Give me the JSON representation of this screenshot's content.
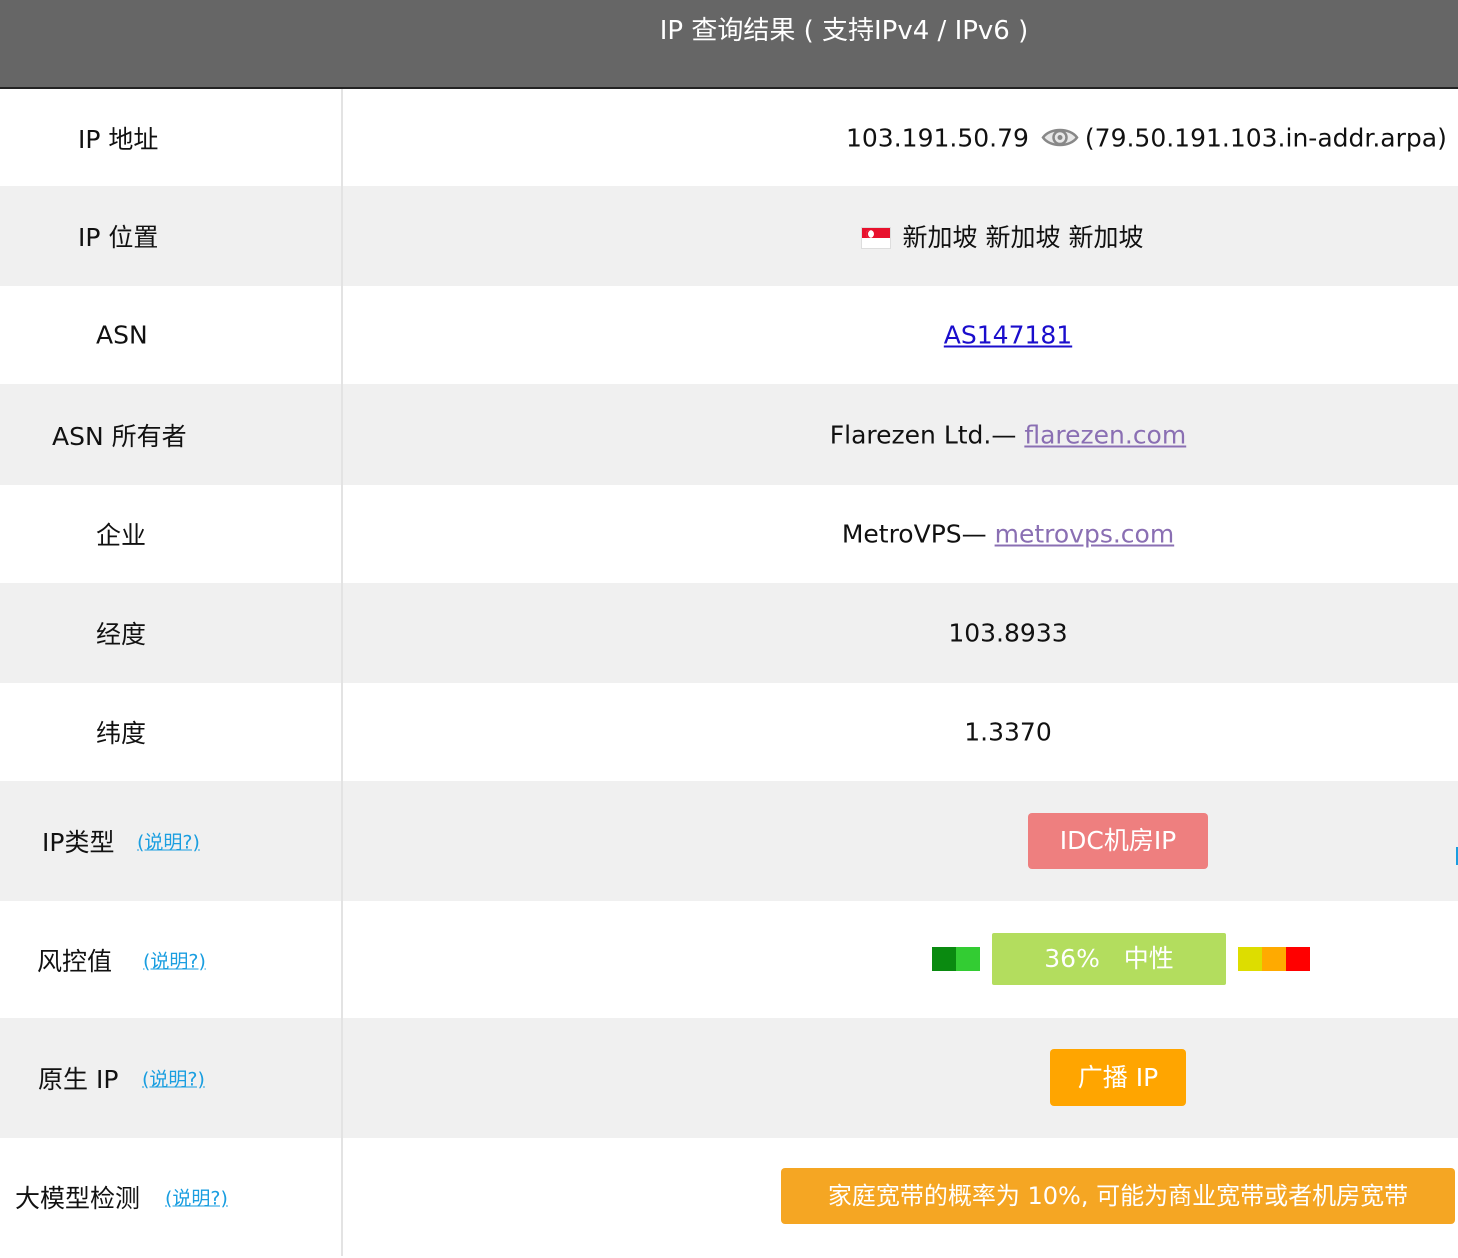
{
  "header": {
    "title": "IP 查询结果 ( 支持IPv4 / IPv6 )"
  },
  "rows": {
    "ip_address": {
      "label": "IP 地址",
      "ip": "103.191.50.79",
      "ptr": "(79.50.191.103.in-addr.arpa)",
      "icon": "eye-icon"
    },
    "ip_location": {
      "label": "IP 位置",
      "flag": "singapore-flag-icon",
      "value": "新加坡 新加坡 新加坡"
    },
    "asn": {
      "label": "ASN",
      "value": "AS147181"
    },
    "asn_owner": {
      "label": "ASN 所有者",
      "name": "Flarezen Ltd.—",
      "link": "flarezen.com"
    },
    "company": {
      "label": "企业",
      "name": "MetroVPS—",
      "link": "metrovps.com"
    },
    "longitude": {
      "label": "经度",
      "value": "103.8933"
    },
    "latitude": {
      "label": "纬度",
      "value": "1.3370"
    },
    "ip_type": {
      "label": "IP类型",
      "help": "(说明?)",
      "badge": "IDC机房IP",
      "badge_color": "#ee7f7f"
    },
    "risk": {
      "label": "风控值",
      "help": "(说明?)",
      "percent": "36%",
      "level": "中性",
      "value_percent": 36,
      "badge_color": "#b3dd5e",
      "scale_colors": [
        "#0a8a10",
        "#33cc33",
        "#b3dd5e",
        "#dddd00",
        "#ffaa00",
        "#ff0000"
      ]
    },
    "native_ip": {
      "label": "原生 IP",
      "help": "(说明?)",
      "badge": "广播 IP",
      "badge_color": "#ffa500"
    },
    "llm_detect": {
      "label": "大模型检测",
      "help": "(说明?)",
      "badge": "家庭宽带的概率为 10%, 可能为商业宽带或者机房宽带",
      "badge_color": "#f5a623"
    }
  }
}
